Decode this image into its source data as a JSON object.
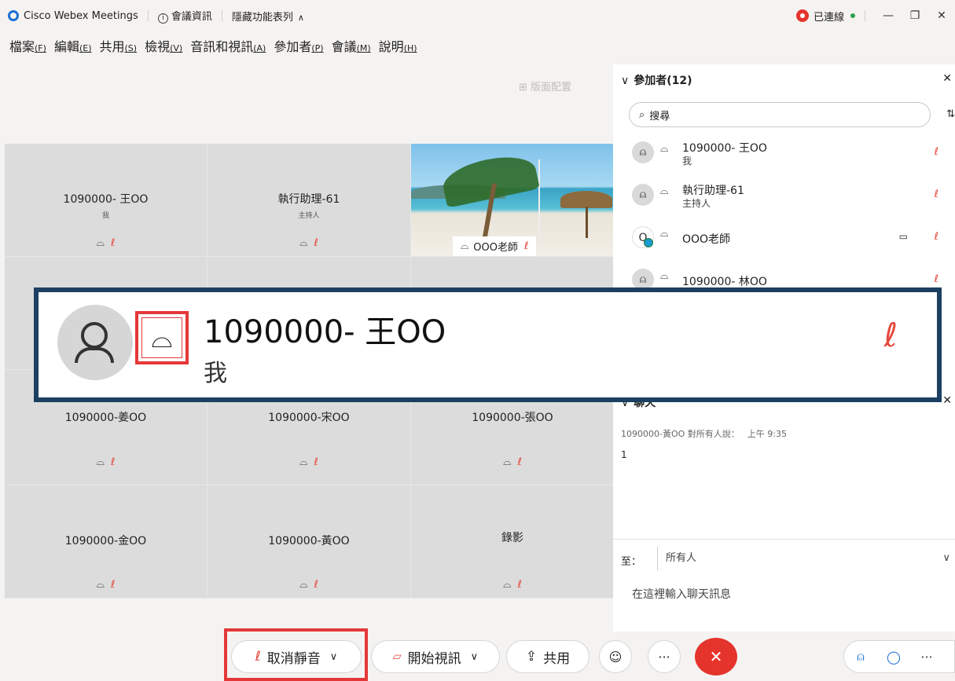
{
  "titlebar": {
    "app_name": "Cisco Webex Meetings",
    "meeting_info": "會議資訊",
    "hide_menu": "隱藏功能表列",
    "connection_status": "已連線",
    "minimize": "—",
    "restore": "❐",
    "close": "✕"
  },
  "menu": [
    {
      "label": "檔案",
      "key": "(F)"
    },
    {
      "label": "編輯",
      "key": "(E)"
    },
    {
      "label": "共用",
      "key": "(S)"
    },
    {
      "label": "檢視",
      "key": "(V)"
    },
    {
      "label": "音訊和視訊",
      "key": "(A)"
    },
    {
      "label": "參加者",
      "key": "(P)"
    },
    {
      "label": "會議",
      "key": "(M)"
    },
    {
      "label": "說明",
      "key": "(H)"
    }
  ],
  "layout_button": "版面配置",
  "grid": [
    {
      "name": "1090000- 王OO",
      "sub": "我"
    },
    {
      "name": "執行助理-61",
      "sub": "主持人"
    },
    {
      "name": "OOO老師",
      "sub": ""
    },
    {
      "name": "1090000-姜OO",
      "sub": ""
    },
    {
      "name": "1090000-宋OO",
      "sub": ""
    },
    {
      "name": "1090000-張OO",
      "sub": ""
    },
    {
      "name": "1090000-金OO",
      "sub": ""
    },
    {
      "name": "1090000-黃OO",
      "sub": ""
    },
    {
      "name": "錄影",
      "sub": ""
    }
  ],
  "participants": {
    "header": "參加者",
    "count": "(12)",
    "search_placeholder": "搜尋",
    "items": [
      {
        "name": "1090000- 王OO",
        "role": "我"
      },
      {
        "name": "執行助理-61",
        "role": "主持人"
      },
      {
        "name": "OOO老師",
        "role": ""
      },
      {
        "name": "1090000- 林OO",
        "role": ""
      }
    ]
  },
  "chat": {
    "header": "聊天",
    "sender": "1090000-黃OO 對所有人說：",
    "time": "上午 9:35",
    "message": "1",
    "to_label": "至：",
    "to_value": "所有人",
    "input_placeholder": "在這裡輸入聊天訊息"
  },
  "zoom": {
    "name": "1090000- 王OO",
    "role": "我"
  },
  "toolbar": {
    "unmute": "取消靜音",
    "start_video": "開始視訊",
    "share": "共用"
  },
  "colors": {
    "accent": "#1a6fd8",
    "mute_red": "#e5483d",
    "end_red": "#e4342c",
    "highlight_border": "#1c3f62"
  },
  "icons": {
    "headset": "headset-icon",
    "muted_mic": "muted-mic-icon",
    "camera": "camera-icon",
    "reaction": "emoji-icon"
  }
}
